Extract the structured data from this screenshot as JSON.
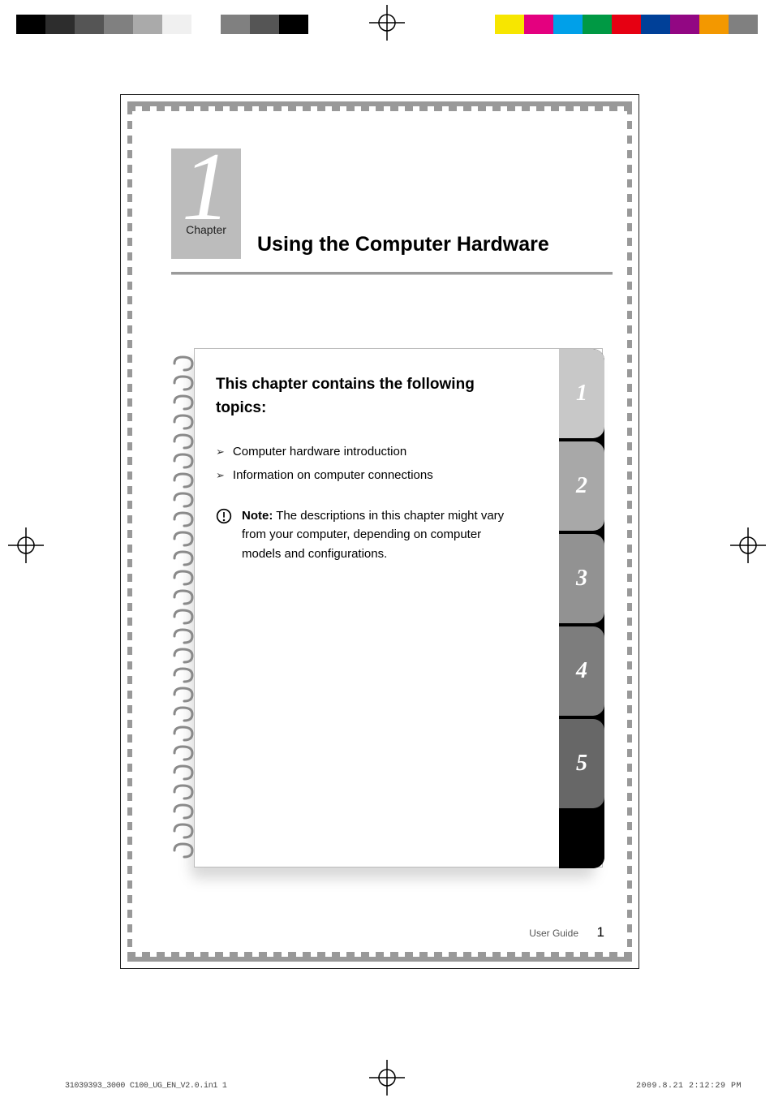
{
  "color_bars_left": [
    "#000000",
    "#2d2d2d",
    "#555555",
    "#808080",
    "#aaaaaa",
    "#f0f0f0",
    "#ffffff",
    "#808080",
    "#555555",
    "#000000"
  ],
  "color_bars_right": [
    "#ffffff",
    "#f7e600",
    "#e4007f",
    "#00a0e9",
    "#009944",
    "#e60012",
    "#004098",
    "#920783",
    "#f39800",
    "#808080"
  ],
  "chapter": {
    "number": "1",
    "word": "Chapter",
    "title": "Using the Computer Hardware"
  },
  "panel": {
    "heading": "This chapter contains the following topics:",
    "topics": [
      "Computer hardware introduction",
      "Information on computer connections"
    ],
    "note_label": "Note:",
    "note_body": " The descriptions in this chapter might vary from your computer, depending on computer models and configurations."
  },
  "tabs": [
    "1",
    "2",
    "3",
    "4",
    "5"
  ],
  "footer": {
    "label": "User Guide",
    "page": "1"
  },
  "slug": {
    "left": "31039393_3000 C100_UG_EN_V2.0.in1   1",
    "right": "2009.8.21   2:12:29 PM"
  }
}
